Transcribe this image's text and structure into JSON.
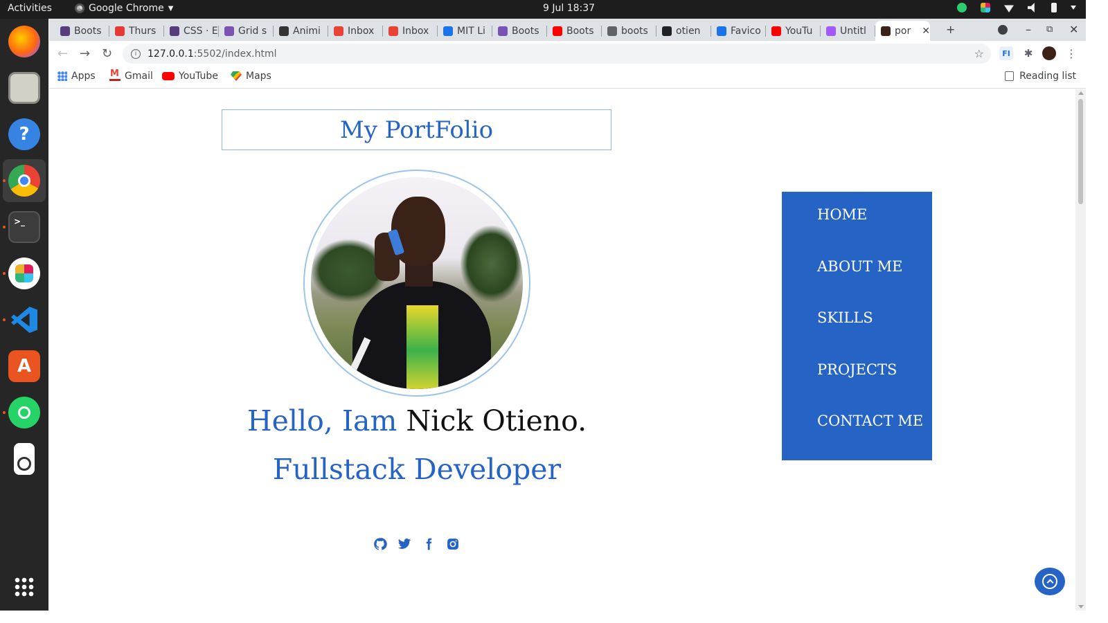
{
  "system": {
    "activities": "Activities",
    "app_name": "Google Chrome",
    "clock": "9 Jul  18:37"
  },
  "browser": {
    "tabs": [
      {
        "label": "Boots",
        "favicon": "bootstrap-icon",
        "color": "#563d7c"
      },
      {
        "label": "Thurs",
        "favicon": "red-ring-icon",
        "color": "#e53935"
      },
      {
        "label": "CSS · E",
        "favicon": "bootstrap-icon",
        "color": "#563d7c"
      },
      {
        "label": "Grid s",
        "favicon": "bootstrap-icon",
        "color": "#7952b3"
      },
      {
        "label": "Animi",
        "favicon": "animista-icon",
        "color": "#333333"
      },
      {
        "label": "Inbox",
        "favicon": "gmail-icon",
        "color": "#ea4335"
      },
      {
        "label": "Inbox",
        "favicon": "gmail-icon",
        "color": "#ea4335"
      },
      {
        "label": "MIT Li",
        "favicon": "code-icon",
        "color": "#1a73e8"
      },
      {
        "label": "Boots",
        "favicon": "bootstrap-icon",
        "color": "#7952b3"
      },
      {
        "label": "Boots",
        "favicon": "youtube-icon",
        "color": "#ff0000"
      },
      {
        "label": "boots",
        "favicon": "globe-icon",
        "color": "#5f6368"
      },
      {
        "label": "otien",
        "favicon": "github-icon",
        "color": "#202124"
      },
      {
        "label": "Favico",
        "favicon": "favicon-icon",
        "color": "#1a73e8"
      },
      {
        "label": "YouTu",
        "favicon": "youtube-icon",
        "color": "#ff0000"
      },
      {
        "label": "Untitl",
        "favicon": "figma-icon",
        "color": "#a259ff"
      },
      {
        "label": "por",
        "favicon": "portfolio-icon",
        "color": "#3a2218",
        "active": true
      }
    ],
    "url_host": "127.0.0.1",
    "url_path": ":5502/index.html",
    "bookmarks": [
      "Apps",
      "Gmail",
      "YouTube",
      "Maps"
    ],
    "reading_list": "Reading list"
  },
  "page": {
    "title": "My PortFolio",
    "greeting_prefix": "Hello, Iam",
    "greeting_name": "Nick Otieno.",
    "role": "Fullstack Developer",
    "nav": [
      "HOME",
      "ABOUT ME",
      "SKILLS",
      "PROJECTS",
      "CONTACT ME"
    ],
    "socials": [
      "github-icon",
      "twitter-icon",
      "facebook-icon",
      "instagram-icon"
    ],
    "accent_color": "#2563c4"
  }
}
